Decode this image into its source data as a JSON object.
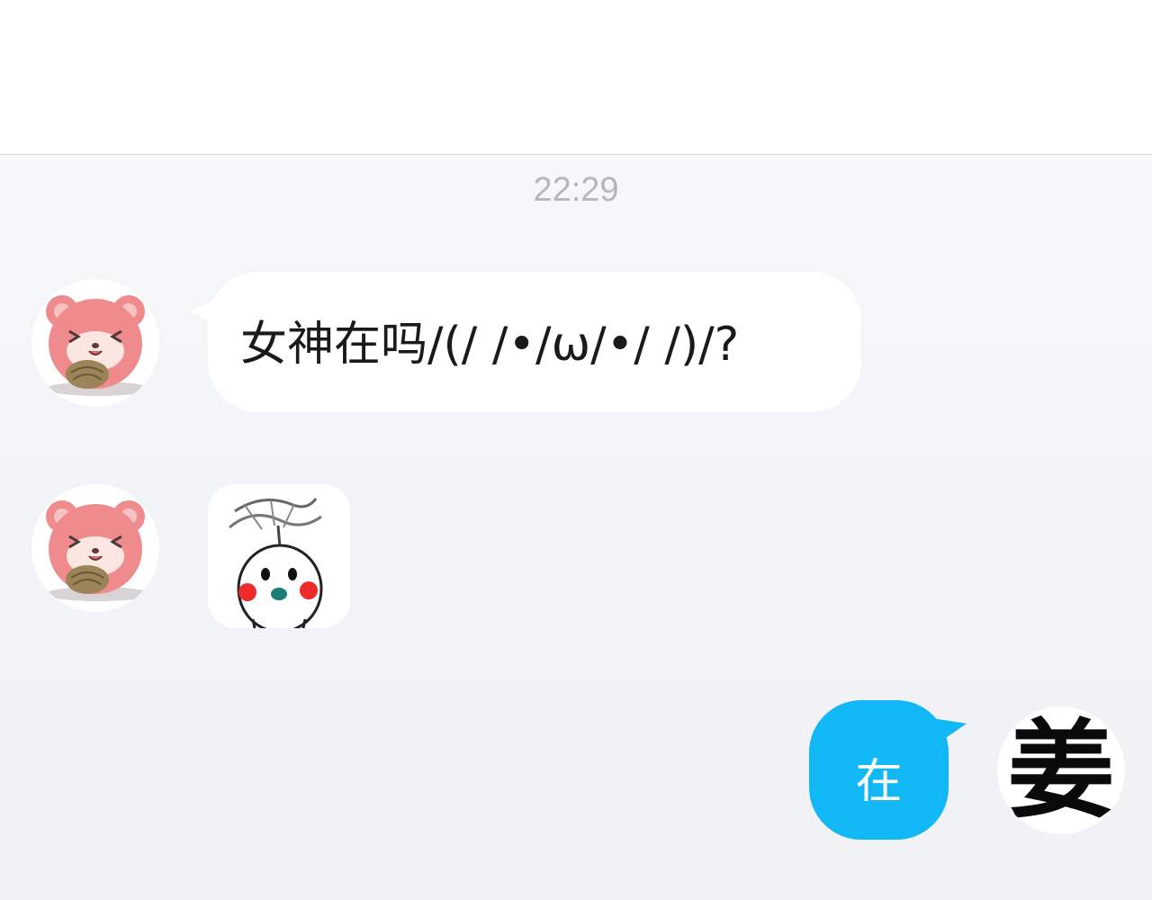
{
  "chat": {
    "timestamp": "22:29",
    "messages": [
      {
        "sender": "other",
        "type": "text",
        "text": "女神在吗/(/ /•/ω/•/ /)/?"
      },
      {
        "sender": "other",
        "type": "sticker",
        "icon": "doodle-face-sticker-icon"
      },
      {
        "sender": "self",
        "type": "text",
        "text": "在"
      }
    ],
    "self_avatar_char": "姜"
  },
  "colors": {
    "outgoing_bubble": "#12b7f5",
    "incoming_bubble": "#ffffff",
    "chat_background": "#f2f3f6",
    "timestamp_text": "#b4b7bc"
  }
}
